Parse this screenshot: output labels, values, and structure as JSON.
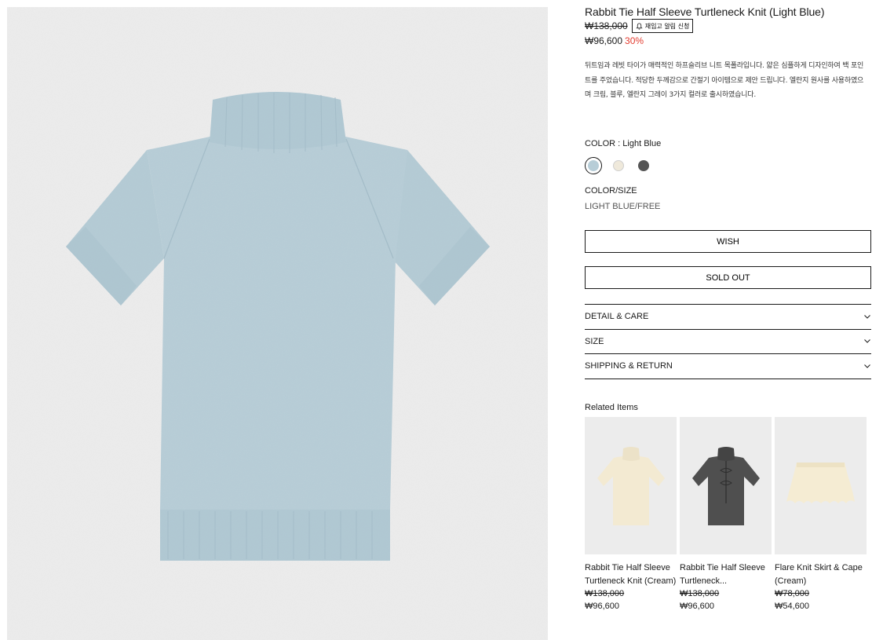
{
  "product": {
    "title": "Rabbit Tie Half Sleeve Turtleneck Knit (Light Blue)",
    "original_price": "₩138,000",
    "restock_label": "재입고 알림 신청",
    "sale_price": "₩96,600",
    "discount": "30%",
    "description": "뒤트임과 레빗 타이가 매력적인 하프슬리브 니트 목폴라입니다. 얇은 심플하게 디자인하여 백 포인트를 주었습니다. 적당한 두께감으로 간절기 아이템으로 제안 드립니다. 엘란지 원사를 사용하였으며 크림, 블루, 엘란지 그레이 3가지 컬러로 출시하였습니다."
  },
  "color": {
    "label": "COLOR : Light Blue",
    "swatches": [
      {
        "name": "Light Blue",
        "hex": "#b7cdd7",
        "selected": true
      },
      {
        "name": "Cream",
        "hex": "#efe9db",
        "selected": false
      },
      {
        "name": "Gray",
        "hex": "#555555",
        "selected": false
      }
    ]
  },
  "size": {
    "label": "COLOR/SIZE",
    "value": "LIGHT BLUE/FREE"
  },
  "buttons": {
    "wish": "WISH",
    "sold_out": "SOLD OUT"
  },
  "accordion": [
    "DETAIL & CARE",
    "SIZE",
    "SHIPPING & RETURN"
  ],
  "related": {
    "title": "Related Items",
    "items": [
      {
        "name": "Rabbit Tie Half Sleeve Turtleneck Knit (Cream)",
        "original_price": "₩138,000",
        "sale_price": "₩96,600",
        "color": "#f3ead2"
      },
      {
        "name": "Rabbit Tie Half Sleeve Turtleneck...",
        "original_price": "₩138,000",
        "sale_price": "₩96,600",
        "color": "#4f4f4f"
      },
      {
        "name": "Flare Knit Skirt & Cape (Cream)",
        "original_price": "₩78,000",
        "sale_price": "₩54,600",
        "color": "#f5ecd3"
      }
    ]
  },
  "colors": {
    "discount": "#e23a2e",
    "sweater": "#b7cdd7",
    "background": "#ececec"
  }
}
